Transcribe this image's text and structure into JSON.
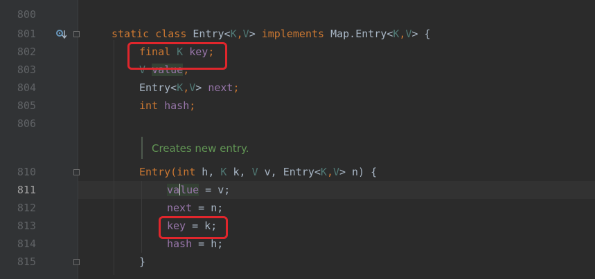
{
  "colors": {
    "background": "#2b2b2b",
    "gutter": "#313335",
    "keyword": "#cc7832",
    "type_param": "#507874",
    "field": "#9876aa",
    "plain": "#a9b7c6",
    "doc_comment": "#629755",
    "highlight_box": "#e0262c"
  },
  "line_numbers": [
    "800",
    "801",
    "802",
    "803",
    "804",
    "805",
    "806",
    "810",
    "811",
    "812",
    "813",
    "814",
    "815"
  ],
  "active_line": "811",
  "doc_comment": "Creates new entry.",
  "code": {
    "l801": {
      "static": "static",
      "class": "class",
      "entry": " Entry<",
      "k": "K",
      "comma": ",",
      "v": "V",
      "gt": "> ",
      "implements": "implements",
      "map": " Map.Entry<",
      "k2": "K",
      "comma2": ",",
      "v2": "V",
      "end": "> {"
    },
    "l802": {
      "final": "final",
      "k": " K ",
      "key": "key",
      "semi": ";"
    },
    "l803": {
      "v": "V",
      "value": "value",
      "semi": ";"
    },
    "l804": {
      "entry": "Entry<",
      "k": "K",
      "comma": ",",
      "v": "V",
      "gt": "> ",
      "next": "next",
      "semi": ";"
    },
    "l805": {
      "int": "int",
      "hash": " hash",
      "semi": ";"
    },
    "l810": {
      "ctor": "Entry(",
      "int": "int",
      "h": " h, ",
      "k": "K",
      "kk": " k, ",
      "v": "V",
      "vv": " v, ",
      "entry": "Entry<",
      "k2": "K",
      "comma": ",",
      "v2": "V",
      "rest": "> n) {"
    },
    "l811": {
      "va": "va",
      "lue": "lue",
      "rest": " = v;"
    },
    "l812": {
      "next": "next",
      "rest": " = n;"
    },
    "l813": {
      "key": "key",
      "rest": " = k;"
    },
    "l814": {
      "hash": "hash",
      "rest": " = h;"
    },
    "l815": {
      "brace": "}"
    }
  }
}
